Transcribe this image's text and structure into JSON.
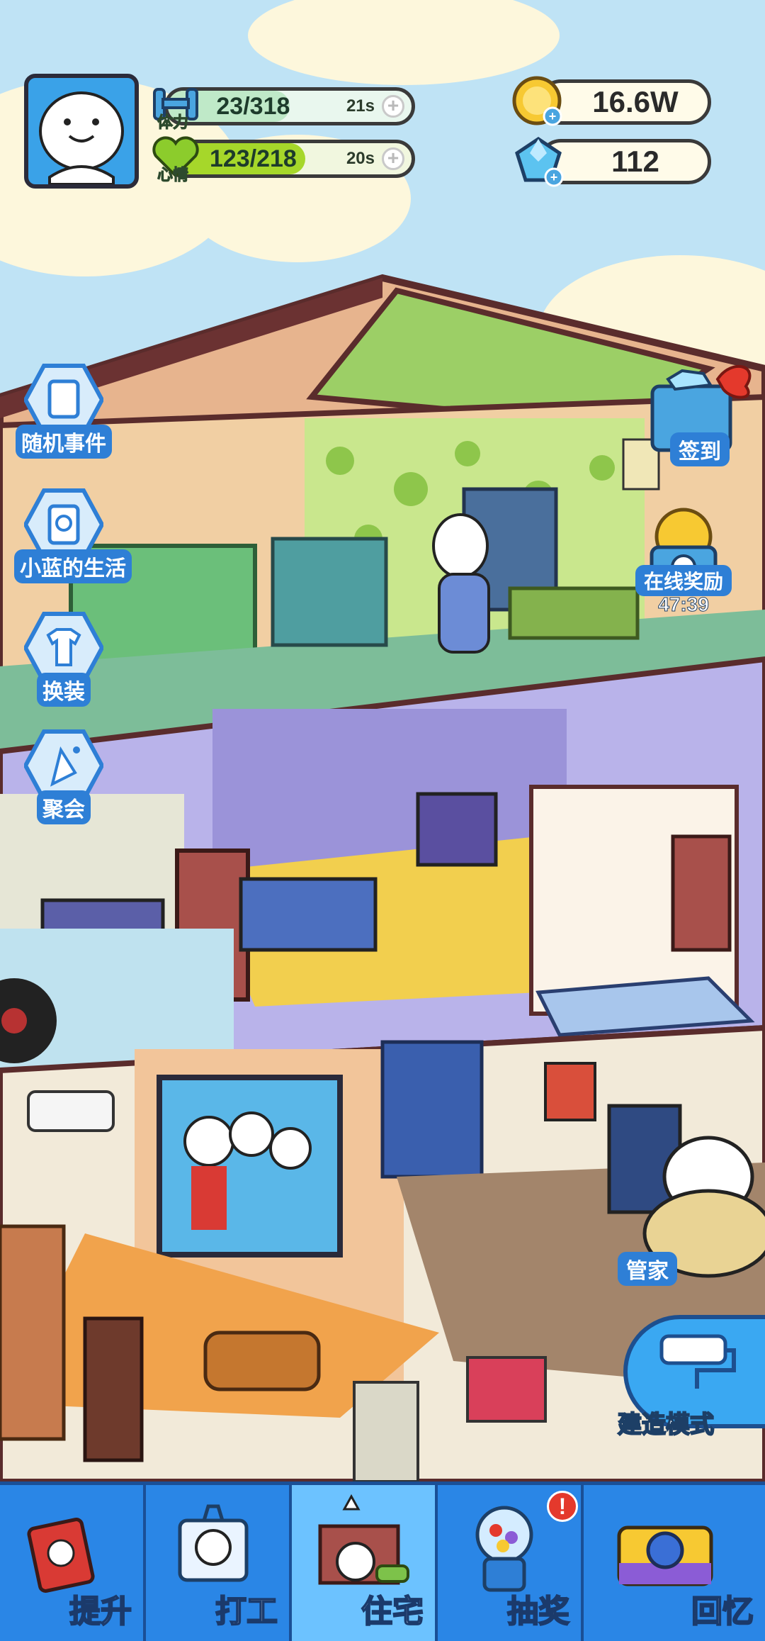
{
  "hud": {
    "stamina": {
      "label": "体力",
      "value": "23/318",
      "timer": "21s",
      "fill_fraction": 0.072
    },
    "mood": {
      "label": "心情",
      "value": "123/218",
      "timer": "20s",
      "fill_fraction": 0.564
    },
    "coins": "16.6W",
    "gems": "112"
  },
  "left_menu": [
    {
      "label": "随机事件",
      "icon": "event-note-icon"
    },
    {
      "label": "小蓝的生活",
      "icon": "diary-icon"
    },
    {
      "label": "换装",
      "icon": "tshirt-icon"
    },
    {
      "label": "聚会",
      "icon": "party-popper-icon"
    }
  ],
  "right_menu": {
    "checkin_label": "签到",
    "online_reward_label": "在线奖励",
    "online_reward_timer": "47:39",
    "butler_label": "管家",
    "build_mode_label": "建造模式"
  },
  "nav": [
    {
      "label": "提升",
      "icon": "book-icon",
      "active": false,
      "badge": false
    },
    {
      "label": "打工",
      "icon": "work-badge-icon",
      "active": false,
      "badge": false
    },
    {
      "label": "住宅",
      "icon": "house-icon",
      "active": true,
      "badge": false
    },
    {
      "label": "抽奖",
      "icon": "gacha-machine-icon",
      "active": false,
      "badge": true
    },
    {
      "label": "回忆",
      "icon": "camera-icon",
      "active": false,
      "badge": false
    }
  ],
  "badge_text": "!",
  "colors": {
    "sky": "#bfe3f5",
    "stamina_fill": "#bfe9c8",
    "mood_fill": "#a6d72a",
    "nav_blue": "#2a86e6",
    "nav_active": "#6cc2ff",
    "badge_red": "#e4392c"
  }
}
